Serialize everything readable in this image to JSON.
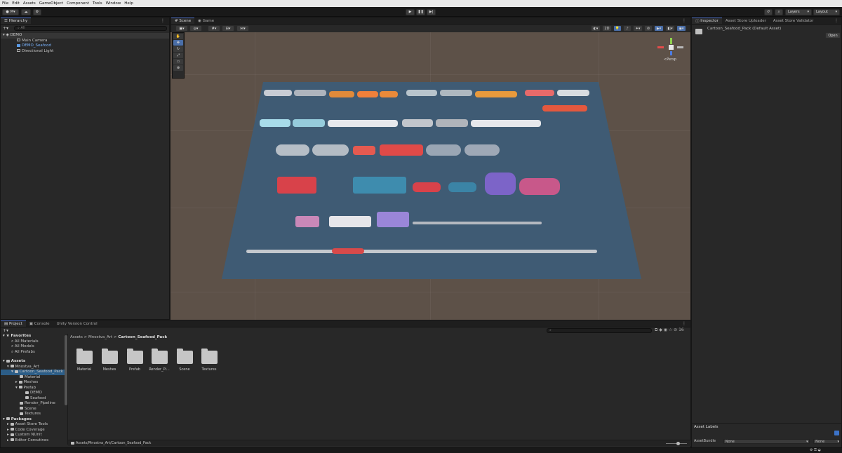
{
  "menu": [
    "File",
    "Edit",
    "Assets",
    "GameObject",
    "Component",
    "Tools",
    "Window",
    "Help"
  ],
  "toolbar": {
    "account": "M",
    "layers": "Layers",
    "layout": "Layout"
  },
  "hierarchy": {
    "tab": "Hierarchy",
    "search_placeholder": "All",
    "items": [
      "DEMO",
      "Main Camera",
      "DEMO_Seafood",
      "Directional Light"
    ]
  },
  "scene": {
    "tabs": [
      "Scene",
      "Game"
    ],
    "gizmo_label": "<Persp",
    "toggle_2d": "2D"
  },
  "inspector": {
    "tabs": [
      "Inspector",
      "Asset Store Uploader",
      "Asset Store Validator"
    ],
    "asset_name": "Cartoon_Seafood_Pack (Default Asset)",
    "open_button": "Open",
    "asset_labels": "Asset Labels",
    "assetbundle_label": "AssetBundle",
    "assetbundle_value": "None",
    "variant_value": "None"
  },
  "project": {
    "tabs": [
      "Project",
      "Console",
      "Unity Version Control"
    ],
    "breadcrumb": [
      "Assets",
      "Mnostva_Art",
      "Cartoon_Seafood_Pack"
    ],
    "favorites": "Favorites",
    "favorite_items": [
      "All Materials",
      "All Models",
      "All Prefabs"
    ],
    "assets": "Assets",
    "tree": [
      "Mnostva_Art",
      "Cartoon_Seafood_Pack",
      "Material",
      "Meshes",
      "Prefab",
      "DEMO",
      "Seafood",
      "Render_Pipeline",
      "Scene",
      "Textures"
    ],
    "packages": "Packages",
    "package_items": [
      "Asset Store Tools",
      "Code Coverage",
      "Custom NUnit",
      "Editor Coroutines"
    ],
    "folders": [
      "Material",
      "Meshes",
      "Prefab",
      "Render_Pi...",
      "Scene",
      "Textures"
    ],
    "footer_path": "Assets/Mnostva_Art/Cartoon_Seafood_Pack",
    "hidden_count": "16"
  }
}
